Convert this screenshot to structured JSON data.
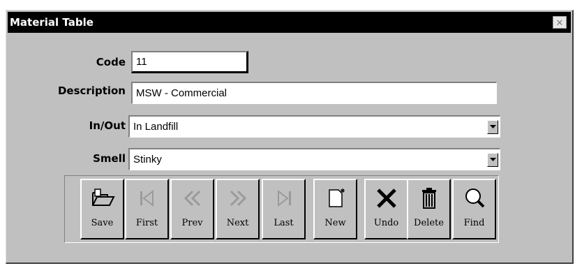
{
  "window": {
    "title": "Material Table",
    "close_glyph": "✕"
  },
  "form": {
    "code": {
      "label": "Code",
      "value": "11"
    },
    "description": {
      "label": "Description",
      "value": "MSW - Commercial"
    },
    "in_out": {
      "label": "In/Out",
      "value": "In Landfill"
    },
    "smell": {
      "label": "Smell",
      "value": "Stinky"
    }
  },
  "toolbar": {
    "save": "Save",
    "first": "First",
    "prev": "Prev",
    "next": "Next",
    "last": "Last",
    "new": "New",
    "undo": "Undo",
    "delete": "Delete",
    "find": "Find"
  },
  "colors": {
    "titlebar": "#000000",
    "window": "#c0c0c0",
    "disabled_icon": "#9a9a9a"
  }
}
